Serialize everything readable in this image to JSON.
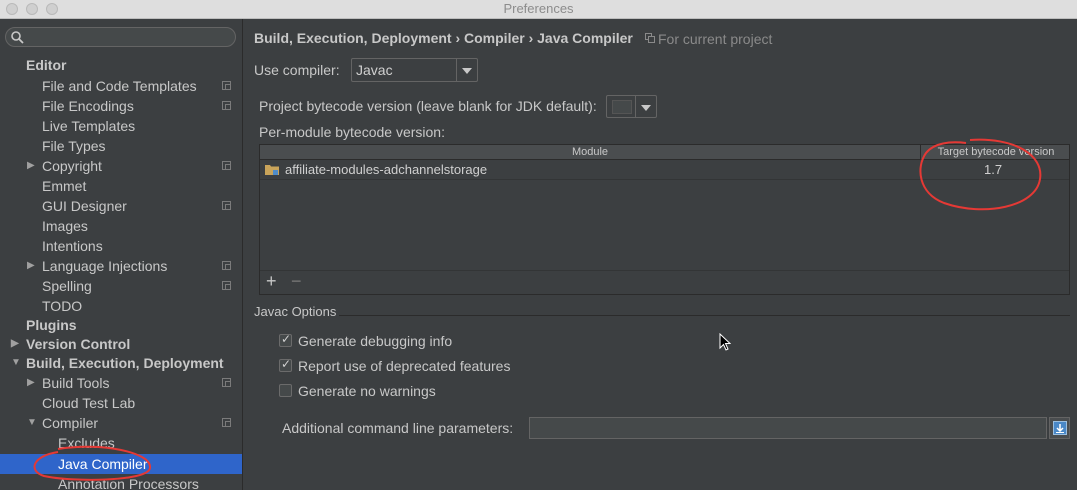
{
  "window": {
    "title": "Preferences"
  },
  "sidebar": {
    "search_placeholder": "",
    "items": [
      {
        "label": "Editor"
      },
      {
        "label": "File and Code Templates"
      },
      {
        "label": "File Encodings"
      },
      {
        "label": "Live Templates"
      },
      {
        "label": "File Types"
      },
      {
        "label": "Copyright"
      },
      {
        "label": "Emmet"
      },
      {
        "label": "GUI Designer"
      },
      {
        "label": "Images"
      },
      {
        "label": "Intentions"
      },
      {
        "label": "Language Injections"
      },
      {
        "label": "Spelling"
      },
      {
        "label": "TODO"
      },
      {
        "label": "Plugins"
      },
      {
        "label": "Version Control"
      },
      {
        "label": "Build, Execution, Deployment"
      },
      {
        "label": "Build Tools"
      },
      {
        "label": "Cloud Test Lab"
      },
      {
        "label": "Compiler"
      },
      {
        "label": "Excludes"
      },
      {
        "label": "Java Compiler"
      },
      {
        "label": "Annotation Processors"
      }
    ]
  },
  "main": {
    "breadcrumb": "Build, Execution, Deployment › Compiler › Java Compiler",
    "for_project": "For current project",
    "use_compiler_label": "Use compiler:",
    "use_compiler_value": "Javac",
    "project_bytecode_label": "Project bytecode version (leave blank for JDK default):",
    "project_bytecode_value": "",
    "per_module_label": "Per-module bytecode version:",
    "table": {
      "columns": [
        "Module",
        "Target bytecode version"
      ],
      "rows": [
        {
          "module": "affiliate-modules-adchannelstorage",
          "target": "1.7"
        }
      ],
      "add": "+",
      "remove": "−"
    },
    "javac_options_title": "Javac Options",
    "options": [
      {
        "label": "Generate debugging info",
        "checked": true
      },
      {
        "label": "Report use of deprecated features",
        "checked": true
      },
      {
        "label": "Generate no warnings",
        "checked": false
      }
    ],
    "additional_params_label": "Additional command line parameters:",
    "additional_params_value": ""
  }
}
